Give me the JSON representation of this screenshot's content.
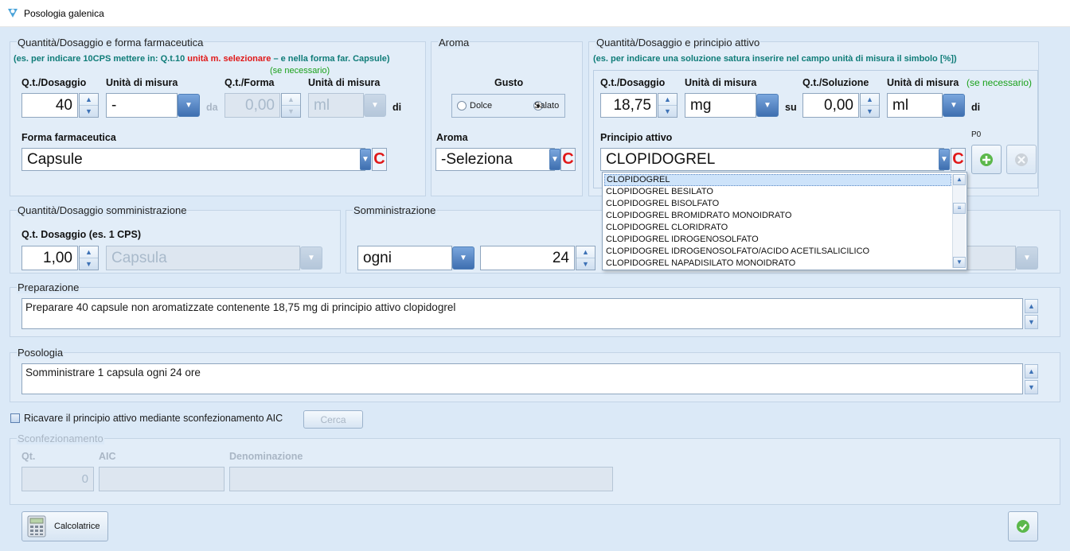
{
  "window": {
    "title": "Posologia galenica"
  },
  "sec1": {
    "title": "Quantità/Dosaggio e forma farmaceutica",
    "hint_a": "(es. per indicare 10CPS mettere in: Q.t.10 ",
    "hint_red": "unità m. selezionare",
    "hint_b": " – e nella forma far. Capsule)",
    "hint_c": "(se necessario)",
    "lbl_qt": "Q.t./Dosaggio",
    "lbl_unit": "Unità di misura",
    "lbl_qtform": "Q.t./Forma",
    "lbl_unit2": "Unità di misura",
    "qt_value": "40",
    "unit_value": "-",
    "da": "da",
    "form_qt_value": "0,00",
    "form_unit_value": "ml",
    "di": "di",
    "lbl_forma": "Forma farmaceutica",
    "forma_value": "Capsule",
    "c": "C"
  },
  "aroma": {
    "title": "Aroma",
    "gusto": "Gusto",
    "dolce": "Dolce",
    "salato": "Salato",
    "lbl": "Aroma",
    "value": "-Seleziona",
    "c": "C"
  },
  "sec3": {
    "title": "Quantità/Dosaggio e principio attivo",
    "hint": "(es. per indicare una soluzione satura inserire nel campo unità di misura il simbolo [%])",
    "lbl_qt": "Q.t./Dosaggio",
    "lbl_unit": "Unità di misura",
    "lbl_qtsol": "Q.t./Soluzione",
    "lbl_unit2": "Unità di misura",
    "se_necessario": "(se necessario)",
    "qt_value": "18,75",
    "unit_value": "mg",
    "su": "su",
    "sol_value": "0,00",
    "sol_unit": "ml",
    "di": "di",
    "lbl_principio": "Principio attivo",
    "principio_value": "CLOPIDOGREL",
    "c": "C",
    "p0": "P0"
  },
  "dropdown": {
    "items": [
      "CLOPIDOGREL",
      "CLOPIDOGREL BESILATO",
      "CLOPIDOGREL BISOLFATO",
      "CLOPIDOGREL BROMIDRATO MONOIDRATO",
      "CLOPIDOGREL CLORIDRATO",
      "CLOPIDOGREL IDROGENOSOLFATO",
      "CLOPIDOGREL IDROGENOSOLFATO/ACIDO ACETILSALICILICO",
      "CLOPIDOGREL NAPADISILATO MONOIDRATO"
    ]
  },
  "somm_qt": {
    "title": "Quantità/Dosaggio somministrazione",
    "lbl": "Q.t. Dosaggio (es. 1 CPS)",
    "value": "1,00",
    "unit": "Capsula"
  },
  "somm": {
    "title": "Somministrazione",
    "freq": "ogni",
    "num": "24"
  },
  "prep": {
    "title": "Preparazione",
    "text": "Preparare 40 capsule non aromatizzate contenente 18,75 mg di principio attivo clopidogrel"
  },
  "posologia": {
    "title": "Posologia",
    "text": "Somministrare 1 capsula ogni 24 ore"
  },
  "aic": {
    "checkbox_label": "Ricavare il principio attivo mediante sconfezionamento AIC",
    "cerca": "Cerca"
  },
  "sconf": {
    "title": "Sconfezionamento",
    "lbl_qt": "Qt.",
    "lbl_aic": "AIC",
    "lbl_den": "Denominazione",
    "qt_value": "0"
  },
  "footer": {
    "calc": "Calcolatrice"
  }
}
